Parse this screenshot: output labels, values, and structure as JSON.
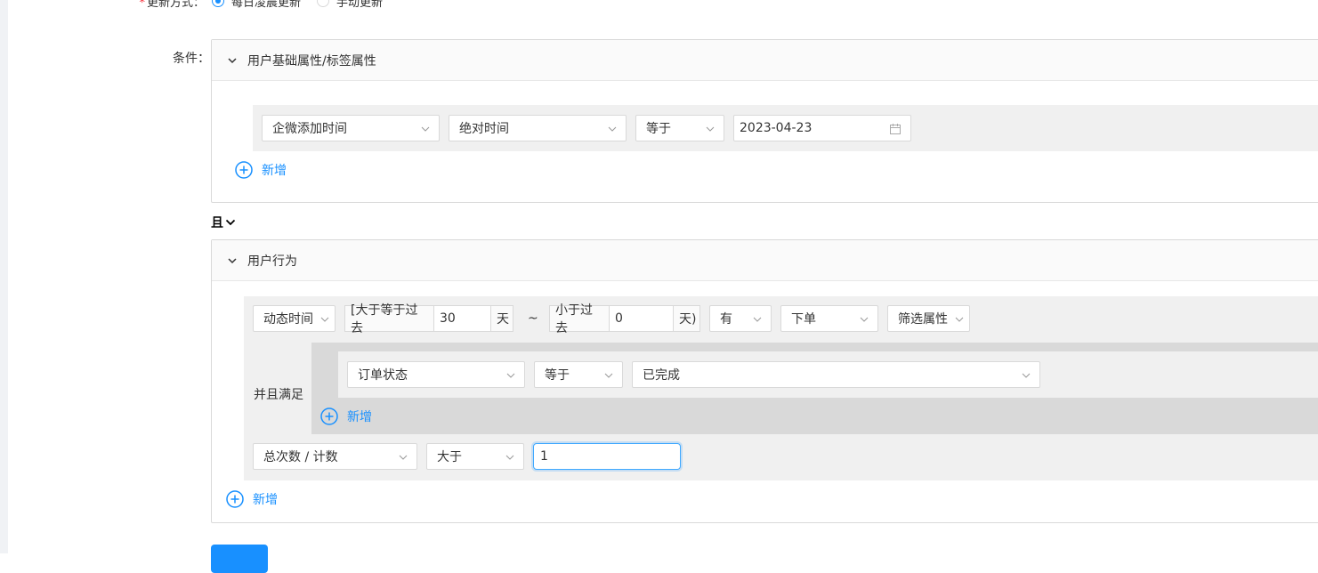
{
  "update": {
    "label": "更新方式：",
    "options": [
      "每日凌晨更新",
      "手动更新"
    ],
    "selected": 0
  },
  "conditions_label": "条件：",
  "group1": {
    "title": "用户基础属性/标签属性",
    "row": {
      "field": "企微添加时间",
      "time_type": "绝对时间",
      "operator": "等于",
      "date": "2023-04-23"
    },
    "add_label": "新增"
  },
  "logic": {
    "label": "且"
  },
  "group2": {
    "title": "用户行为",
    "row": {
      "time_field": "动态时间",
      "from_prefix": "[大于等于过去",
      "from_value": "30",
      "from_unit": "天",
      "tilde": "~",
      "to_prefix": "小于过去",
      "to_value": "0",
      "to_unit": "天)",
      "has": "有",
      "event": "下单",
      "filter": "筛选属性"
    },
    "and_satisfy": "并且满足",
    "sub": {
      "field": "订单状态",
      "operator": "等于",
      "value": "已完成",
      "add_label": "新增"
    },
    "metric": {
      "field": "总次数 / 计数",
      "operator": "大于",
      "value": "1"
    },
    "add_label": "新增"
  },
  "colors": {
    "accent": "#1890ff",
    "border": "#d9d9d9",
    "row_bg": "#f0f0f0"
  }
}
